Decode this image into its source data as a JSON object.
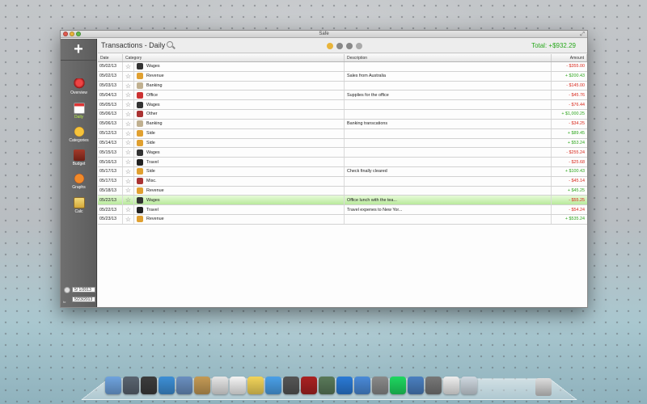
{
  "window": {
    "title": "Safe"
  },
  "sidebar": {
    "add_symbol": "+",
    "items": [
      {
        "label": "Overview",
        "icon": "overview-icon"
      },
      {
        "label": "Daily",
        "icon": "daily-calendar-icon"
      },
      {
        "label": "Categories",
        "icon": "categories-icon"
      },
      {
        "label": "Budget",
        "icon": "budget-icon"
      },
      {
        "label": "Graphs",
        "icon": "graphs-icon"
      },
      {
        "label": "Calc",
        "icon": "calculator-icon"
      }
    ],
    "active_item": "Daily",
    "date_from": "5/ 1/2013",
    "date_to_label": "to",
    "date_to": "5/23/2013"
  },
  "toolbar": {
    "title": "Transactions - Daily",
    "total": "Total: +$932.29"
  },
  "table": {
    "headers": {
      "date": "Date",
      "category": "Category",
      "description": "Description",
      "amount": "Amount"
    },
    "rows": [
      {
        "date": "05/02/13",
        "category": "Wages",
        "description": "",
        "amount": "- $355.00",
        "sign": "neg",
        "icon_color": "#333"
      },
      {
        "date": "05/02/13",
        "category": "Revenue",
        "description": "Sales from Australia",
        "amount": "+ $200.43",
        "sign": "pos",
        "icon_color": "#e0a030"
      },
      {
        "date": "05/03/13",
        "category": "Banking",
        "description": "",
        "amount": "- $145.00",
        "sign": "neg",
        "icon_color": "#c0b090"
      },
      {
        "date": "05/04/13",
        "category": "Office",
        "description": "Supplies for the office",
        "amount": "- $45.76",
        "sign": "neg",
        "icon_color": "#c33"
      },
      {
        "date": "05/05/13",
        "category": "Wages",
        "description": "",
        "amount": "- $76.44",
        "sign": "neg",
        "icon_color": "#333"
      },
      {
        "date": "05/06/13",
        "category": "Other",
        "description": "",
        "amount": "+ $1,000.25",
        "sign": "pos",
        "icon_color": "#a33"
      },
      {
        "date": "05/06/13",
        "category": "Banking",
        "description": "Banking transcations",
        "amount": "- $34.25",
        "sign": "neg",
        "icon_color": "#c0b090"
      },
      {
        "date": "05/12/13",
        "category": "Side",
        "description": "",
        "amount": "+ $89.45",
        "sign": "pos",
        "icon_color": "#e0a030"
      },
      {
        "date": "05/14/13",
        "category": "Side",
        "description": "",
        "amount": "+ $53.24",
        "sign": "pos",
        "icon_color": "#e0a030"
      },
      {
        "date": "05/15/13",
        "category": "Wages",
        "description": "",
        "amount": "- $255.24",
        "sign": "neg",
        "icon_color": "#333"
      },
      {
        "date": "05/16/13",
        "category": "Travel",
        "description": "",
        "amount": "- $25.68",
        "sign": "neg",
        "icon_color": "#222"
      },
      {
        "date": "05/17/13",
        "category": "Side",
        "description": "Check finally cleared",
        "amount": "+ $100.43",
        "sign": "pos",
        "icon_color": "#e0a030"
      },
      {
        "date": "05/17/13",
        "category": "Misc.",
        "description": "",
        "amount": "- $45.14",
        "sign": "neg",
        "icon_color": "#a33"
      },
      {
        "date": "05/18/13",
        "category": "Revenue",
        "description": "",
        "amount": "+ $45.25",
        "sign": "pos",
        "icon_color": "#e0a030"
      },
      {
        "date": "05/22/13",
        "category": "Wages",
        "description": "Office lunch with the tea...",
        "amount": "- $55.25",
        "sign": "neg",
        "icon_color": "#333",
        "selected": true
      },
      {
        "date": "05/22/13",
        "category": "Travel",
        "description": "Travel expenes to New Yor...",
        "amount": "- $54.24",
        "sign": "neg",
        "icon_color": "#222"
      },
      {
        "date": "05/23/13",
        "category": "Revenue",
        "description": "",
        "amount": "+ $535.24",
        "sign": "pos",
        "icon_color": "#e0a030"
      }
    ]
  },
  "dock": {
    "items": [
      {
        "name": "finder-icon",
        "color": "#6fa3de"
      },
      {
        "name": "launchpad-icon",
        "color": "#5a6470"
      },
      {
        "name": "mission-control-icon",
        "color": "#3c3c3c"
      },
      {
        "name": "safari-icon",
        "color": "#3d8fd6"
      },
      {
        "name": "mail-icon",
        "color": "#6a8fc0"
      },
      {
        "name": "contacts-icon",
        "color": "#c49a55"
      },
      {
        "name": "calendar-icon",
        "color": "#e6e6e6"
      },
      {
        "name": "reminders-icon",
        "color": "#f4f4f4"
      },
      {
        "name": "notes-icon",
        "color": "#f2d45a"
      },
      {
        "name": "messages-icon",
        "color": "#4aa0e8"
      },
      {
        "name": "facetime-icon",
        "color": "#555"
      },
      {
        "name": "photo-booth-icon",
        "color": "#a22"
      },
      {
        "name": "iphoto-icon",
        "color": "#5a7a5a"
      },
      {
        "name": "itunes-icon",
        "color": "#2a7ad6"
      },
      {
        "name": "app-store-icon",
        "color": "#4a8ad8"
      },
      {
        "name": "system-preferences-icon",
        "color": "#8a8a8a"
      },
      {
        "name": "spotify-icon",
        "color": "#1ed760"
      },
      {
        "name": "xcode-icon",
        "color": "#4a7fc0"
      },
      {
        "name": "speaker-icon",
        "color": "#777"
      },
      {
        "name": "preview-icon",
        "color": "#eee"
      },
      {
        "name": "finder-window-icon",
        "color": "#cfd8e0"
      }
    ]
  },
  "colors": {
    "positive": "#2ea61d",
    "negative": "#d8281c",
    "selected_row": "#c6f0ac",
    "total": "#28a81c"
  }
}
